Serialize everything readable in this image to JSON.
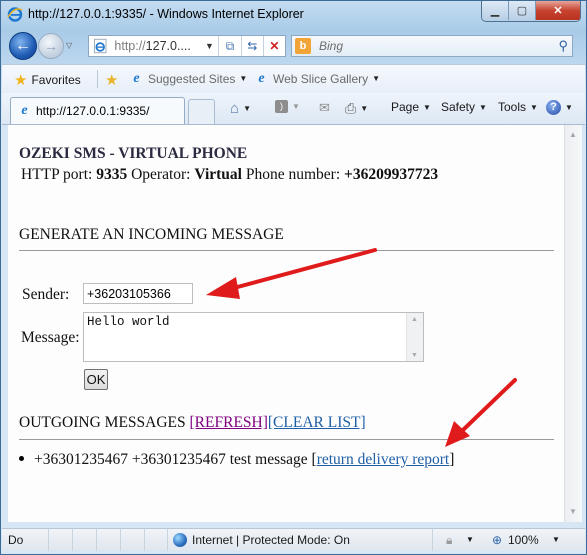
{
  "window": {
    "title": "http://127.0.0.1:9335/ - Windows Internet Explorer",
    "controls": {
      "minimize": "▁",
      "maximize": "▢",
      "close": "✕"
    }
  },
  "nav": {
    "address_prefix": "http://",
    "address_host": "127.0....",
    "search_placeholder": "Bing"
  },
  "favorites_bar": {
    "favorites_label": "Favorites",
    "items": [
      {
        "label": "Suggested Sites",
        "icon": "ie-icon"
      },
      {
        "label": "Web Slice Gallery",
        "icon": "ie-page-icon"
      }
    ]
  },
  "tabs": [
    {
      "label": "http://127.0.0.1:9335/",
      "active": true
    }
  ],
  "command_bar": {
    "page_label": "Page",
    "safety_label": "Safety",
    "tools_label": "Tools"
  },
  "page": {
    "title": "OZEKI SMS - VIRTUAL PHONE",
    "info": {
      "port_label": "HTTP port: ",
      "port_value": "9335",
      "operator_label": " Operator: ",
      "operator_value": "Virtual",
      "phone_label": " Phone number: ",
      "phone_value": "+36209937723"
    },
    "generate_heading": "GENERATE AN INCOMING MESSAGE",
    "sender_label": "Sender:",
    "sender_value": "+36203105366",
    "message_label": "Message:",
    "message_value": "Hello world",
    "ok_label": "OK",
    "outgoing_heading": "OUTGOING MESSAGES ",
    "refresh_link": "[REFRESH]",
    "clear_link": "[CLEAR LIST]",
    "messages": [
      {
        "text": "+36301235467 +36301235467 test message [",
        "link": "return delivery report",
        "suffix": "]"
      }
    ]
  },
  "status_bar": {
    "status_text": "Do",
    "zone_text": "Internet | Protected Mode: On",
    "zoom": "100%"
  },
  "annotation_color": "#e01b1b"
}
